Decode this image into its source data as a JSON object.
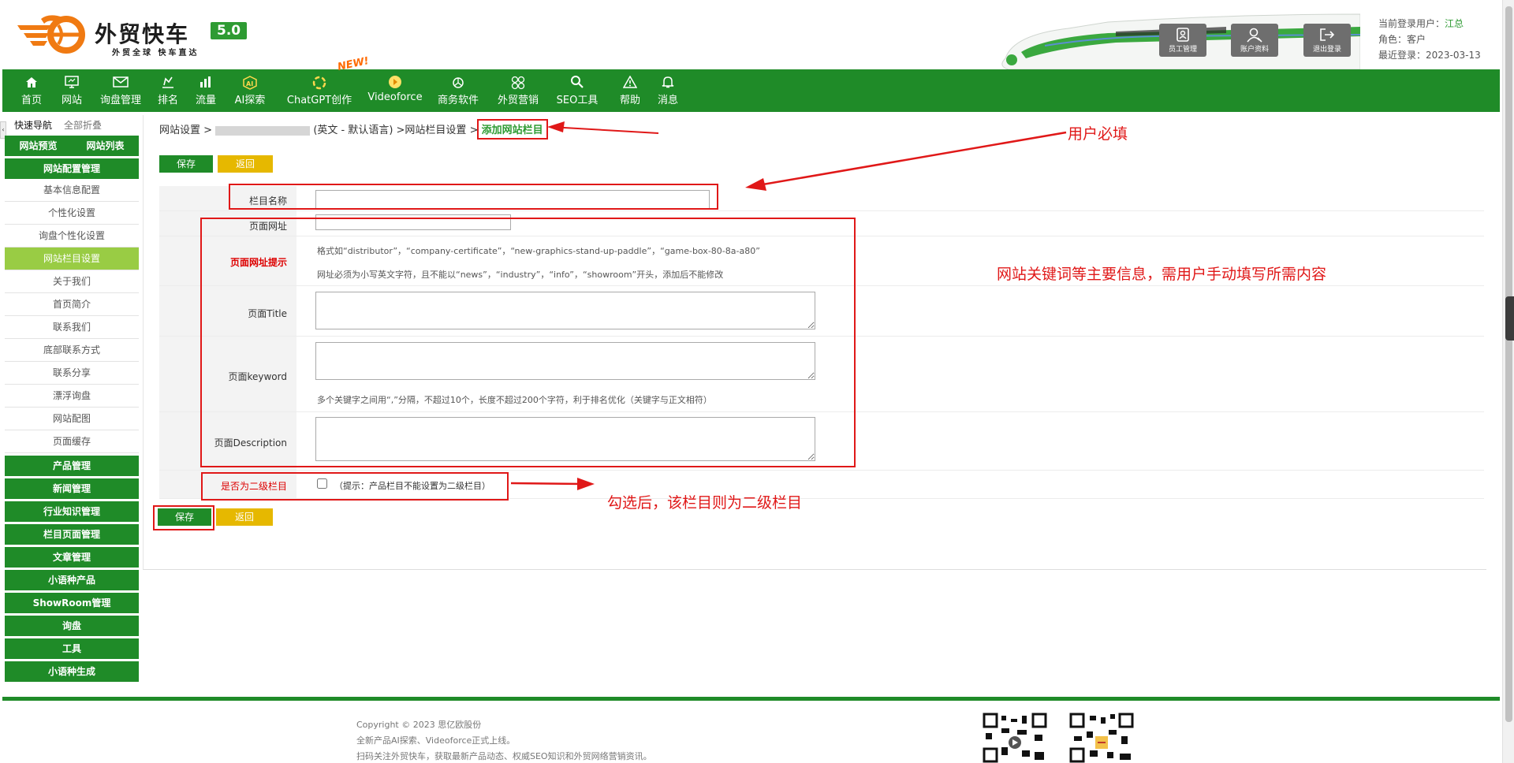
{
  "brand": {
    "name": "外贸快车",
    "version": "5.0",
    "slogan": "外贸全球 快车直达"
  },
  "header_buttons": [
    {
      "label": "员工管理",
      "icon": "staff-icon"
    },
    {
      "label": "账户资料",
      "icon": "account-icon"
    },
    {
      "label": "退出登录",
      "icon": "logout-icon"
    }
  ],
  "user": {
    "current_label": "当前登录用户：",
    "current_value": "江总",
    "role_label": "角色：",
    "role_value": "客户",
    "last_login_label": "最近登录：",
    "last_login_value": "2023-03-13"
  },
  "nav": [
    {
      "label": "首页",
      "icon": "home-icon"
    },
    {
      "label": "网站",
      "icon": "monitor-icon"
    },
    {
      "label": "询盘管理",
      "icon": "mail-icon"
    },
    {
      "label": "排名",
      "icon": "ranking-icon"
    },
    {
      "label": "流量",
      "icon": "bar-chart-icon"
    },
    {
      "label": "AI探索",
      "icon": "ai-icon"
    },
    {
      "label": "ChatGPT创作",
      "icon": "chatgpt-icon"
    },
    {
      "label": "Videoforce",
      "icon": "video-icon"
    },
    {
      "label": "商务软件",
      "icon": "software-icon"
    },
    {
      "label": "外贸营销",
      "icon": "marketing-icon"
    },
    {
      "label": "SEO工具",
      "icon": "search-icon"
    },
    {
      "label": "帮助",
      "icon": "warning-icon"
    },
    {
      "label": "消息",
      "icon": "bell-icon"
    }
  ],
  "new_badge": "NEW!",
  "sidebar": {
    "tab_quick": "快速导航",
    "tab_collapse": "全部折叠",
    "btn_preview": "网站预览",
    "btn_list": "网站列表",
    "section_config": "网站配置管理",
    "config_items": [
      "基本信息配置",
      "个性化设置",
      "询盘个性化设置"
    ],
    "section_column": "网站栏目设置",
    "column_items": [
      "关于我们",
      "首页简介",
      "联系我们",
      "底部联系方式",
      "联系分享",
      "漂浮询盘",
      "网站配图",
      "页面缓存"
    ],
    "sections": [
      "产品管理",
      "新闻管理",
      "行业知识管理",
      "栏目页面管理",
      "文章管理",
      "小语种产品",
      "ShowRoom管理",
      "询盘",
      "工具",
      "小语种生成"
    ]
  },
  "breadcrumb": {
    "part1": "网站设置 >",
    "part2": "(英文 - 默认语言) >网站栏目设置 >",
    "current": "添加网站栏目"
  },
  "buttons": {
    "save": "保存",
    "back": "返回"
  },
  "form": {
    "name_label": "栏目名称",
    "url_label": "页面网址",
    "url_hint_label": "页面网址提示",
    "url_hint_1": "格式如“distributor”，“company-certificate”，“new-graphics-stand-up-paddle”，“game-box-80-8a-a80”",
    "url_hint_2": "网址必须为小写英文字符，且不能以“news”，“industry”，“info”，“showroom”开头，添加后不能修改",
    "title_label": "页面Title",
    "keyword_label": "页面keyword",
    "keyword_hint": "多个关键字之间用“,”分隔，不超过10个，长度不超过200个字符，利于排名优化（关键字与正文相符）",
    "desc_label": "页面Description",
    "second_level_label": "是否为二级栏目",
    "second_level_hint": "（提示：产品栏目不能设置为二级栏目）"
  },
  "annotations": {
    "required": "用户必填",
    "seo_info": "网站关键词等主要信息，需用户手动填写所需内容",
    "second_level": "勾选后，该栏目则为二级栏目"
  },
  "footer": {
    "copyright": "Copyright © 2023 思亿欧股份",
    "line2": "全新产品AI探索、Videoforce正式上线。",
    "line3": "扫码关注外贸快车，获取最新产品动态、权威SEO知识和外贸网络营销资讯。"
  },
  "colors": {
    "primary_green": "#1f8b28",
    "active_green": "#99cc44",
    "back_yellow": "#e6b800",
    "annotation_red": "#e01818"
  }
}
